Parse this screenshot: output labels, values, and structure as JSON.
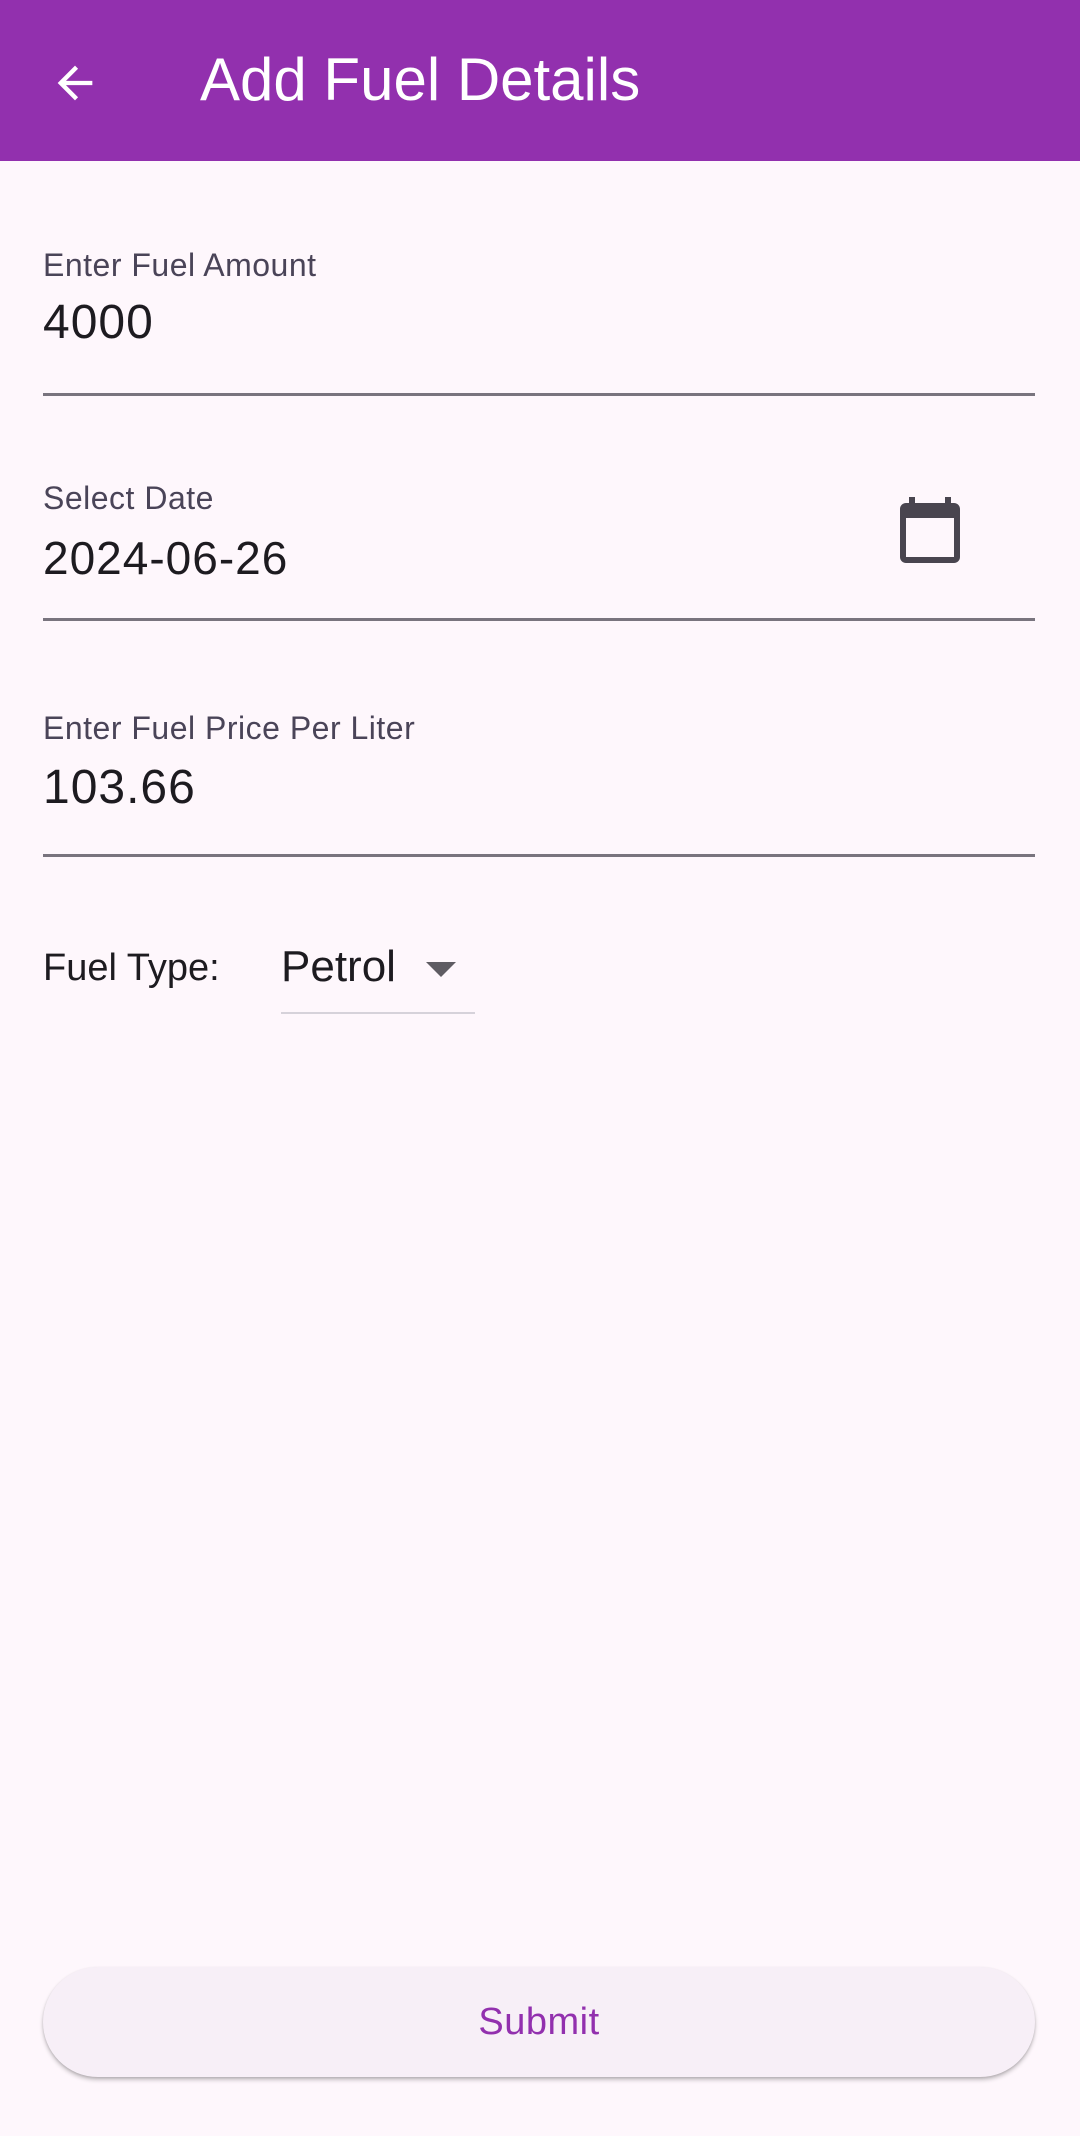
{
  "app_bar": {
    "title": "Add Fuel Details",
    "back_icon": "arrow-back-icon",
    "background_color": "#9230ae"
  },
  "form": {
    "fuel_amount": {
      "label": "Enter Fuel Amount",
      "value": "4000"
    },
    "date": {
      "label": "Select Date",
      "value": "2024-06-26",
      "icon": "calendar-icon"
    },
    "fuel_price": {
      "label": "Enter Fuel Price Per Liter",
      "value": "103.66"
    },
    "fuel_type": {
      "label": "Fuel Type:",
      "selected": "Petrol",
      "icon": "dropdown-arrow-icon"
    }
  },
  "submit": {
    "label": "Submit",
    "text_color": "#9230ae"
  }
}
